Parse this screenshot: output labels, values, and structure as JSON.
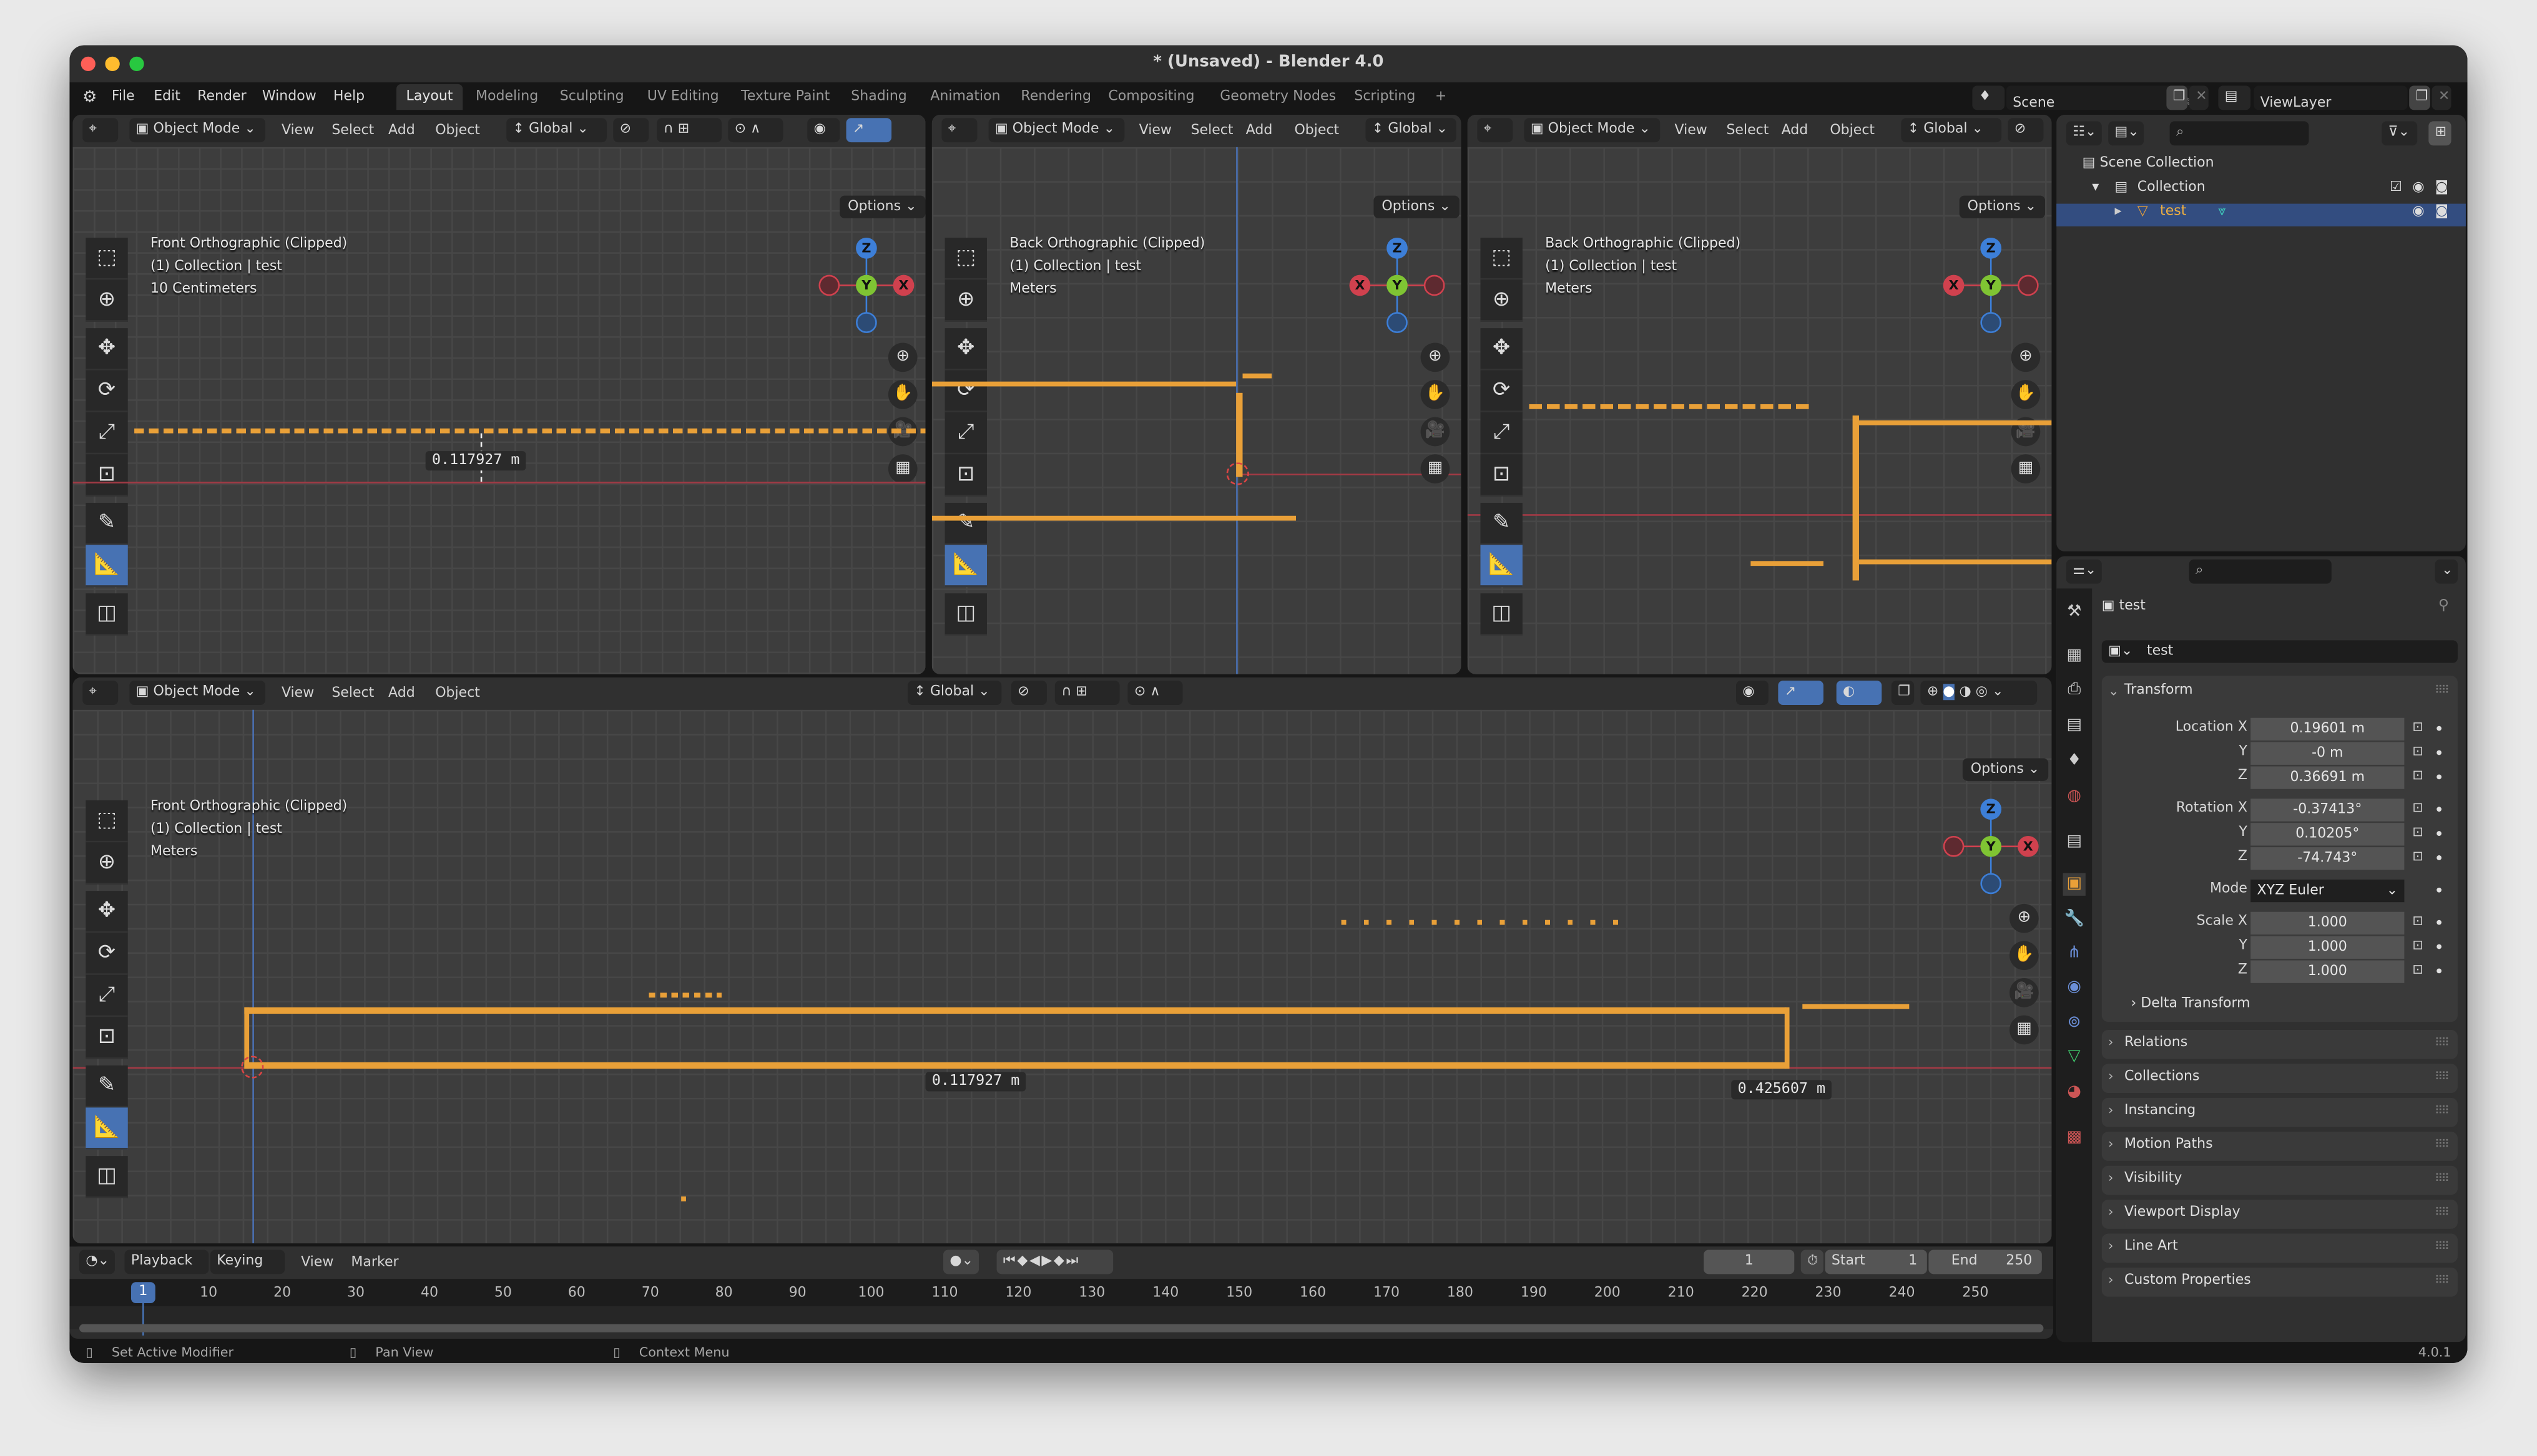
{
  "window": {
    "title": "* (Unsaved) - Blender 4.0"
  },
  "menubar": {
    "items": [
      "File",
      "Edit",
      "Render",
      "Window",
      "Help"
    ],
    "workspaces": [
      "Layout",
      "Modeling",
      "Sculpting",
      "UV Editing",
      "Texture Paint",
      "Shading",
      "Animation",
      "Rendering",
      "Compositing",
      "Geometry Nodes",
      "Scripting"
    ],
    "active_workspace": "Layout",
    "add_workspace": "+",
    "scene": "Scene",
    "view_layer": "ViewLayer"
  },
  "viewport_header": {
    "mode": "Object Mode",
    "menus": [
      "View",
      "Select",
      "Add",
      "Object"
    ],
    "orientation": "Global",
    "options": "Options"
  },
  "viewports": [
    {
      "view": "Front Orthographic (Clipped)",
      "collection": "(1) Collection | test",
      "scale": "10 Centimeters",
      "measurements": [
        "0.117927 m"
      ]
    },
    {
      "view": "Back Orthographic (Clipped)",
      "collection": "(1) Collection | test",
      "scale": "Meters",
      "measurements": []
    },
    {
      "view": "Back Orthographic (Clipped)",
      "collection": "(1) Collection | test",
      "scale": "Meters",
      "measurements": []
    },
    {
      "view": "Front Orthographic (Clipped)",
      "collection": "(1) Collection | test",
      "scale": "Meters",
      "measurements": [
        "0.117927 m",
        "0.425607 m"
      ]
    }
  ],
  "gizmo": {
    "z": "Z",
    "y": "Y",
    "x": "X"
  },
  "outliner": {
    "items": [
      {
        "label": "Scene Collection",
        "icon": "collection-icon"
      },
      {
        "label": "Collection",
        "icon": "collection-icon",
        "checked": true
      },
      {
        "label": "test",
        "icon": "mesh-object-icon",
        "selected": true
      }
    ]
  },
  "properties": {
    "object_name": "test",
    "datablock_name": "test",
    "transform_title": "Transform",
    "location": {
      "label": "Location X",
      "x": "0.19601 m",
      "y": "-0 m",
      "z": "0.36691 m"
    },
    "rotation": {
      "label": "Rotation X",
      "x": "-0.37413°",
      "y": "0.10205°",
      "z": "-74.743°"
    },
    "mode_label": "Mode",
    "mode": "XYZ Euler",
    "scale": {
      "label": "Scale X",
      "x": "1.000",
      "y": "1.000",
      "z": "1.000"
    },
    "axis_labels": {
      "y": "Y",
      "z": "Z"
    },
    "delta_transform": "Delta Transform",
    "panels": [
      "Relations",
      "Collections",
      "Instancing",
      "Motion Paths",
      "Visibility",
      "Viewport Display",
      "Line Art",
      "Custom Properties"
    ]
  },
  "timeline": {
    "menus": [
      "Playback",
      "Keying",
      "View",
      "Marker"
    ],
    "current_frame": "1",
    "start_label": "Start",
    "start": "1",
    "end_label": "End",
    "end": "250",
    "ticks": [
      "10",
      "20",
      "30",
      "40",
      "50",
      "60",
      "70",
      "80",
      "90",
      "100",
      "110",
      "120",
      "130",
      "140",
      "150",
      "160",
      "170",
      "180",
      "190",
      "200",
      "210",
      "220",
      "230",
      "240",
      "250"
    ],
    "playhead": "1"
  },
  "statusbar": {
    "hints": [
      "Set Active Modifier",
      "Pan View",
      "Context Menu"
    ],
    "version": "4.0.1"
  },
  "colors": {
    "accent": "#4772b3",
    "selection": "#e9a038",
    "x_axis": "#d0414e",
    "y_axis": "#7fc433",
    "z_axis": "#3d7fd8"
  }
}
